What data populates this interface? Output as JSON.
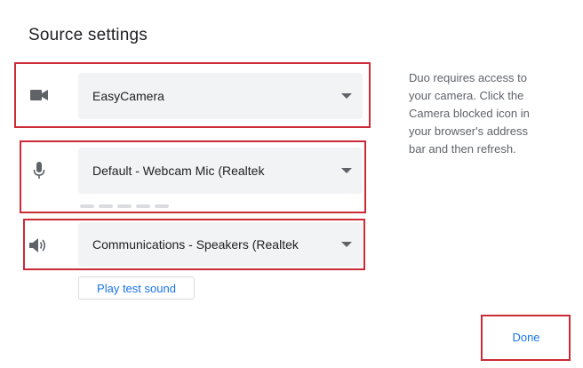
{
  "dialog": {
    "title": "Source settings"
  },
  "camera": {
    "icon": "videocam-icon",
    "selected": "EasyCamera"
  },
  "microphone": {
    "icon": "mic-icon",
    "selected": "Default - Webcam Mic (Realtek"
  },
  "speaker": {
    "icon": "volume-icon",
    "selected": "Communications - Speakers (Realtek"
  },
  "test_sound_label": "Play test sound",
  "info_lines": [
    "Duo requires access to",
    "your camera. Click the",
    "Camera blocked icon in",
    "your browser's address",
    "bar and then refresh."
  ],
  "done_label": "Done",
  "colors": {
    "accent": "#1a73e8",
    "highlight": "#cc2a36",
    "select_bg": "#f1f3f4",
    "icon": "#5f6368"
  }
}
